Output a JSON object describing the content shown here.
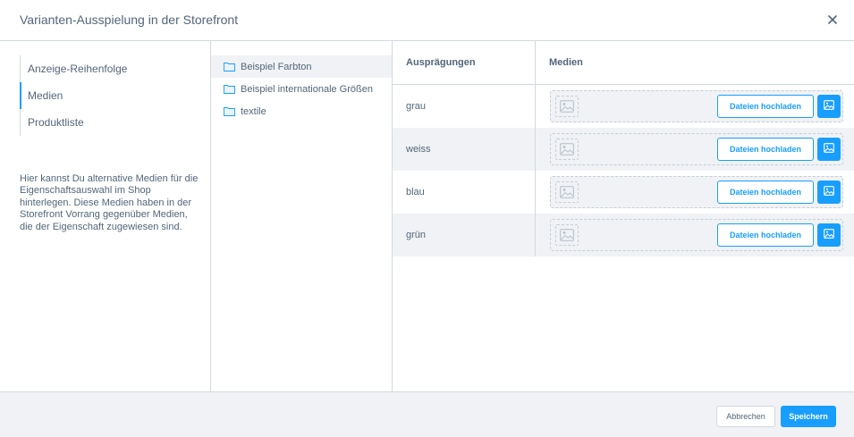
{
  "modal": {
    "title": "Varianten-Ausspielung in der Storefront",
    "close_icon": "close-icon"
  },
  "nav": {
    "items": [
      {
        "label": "Anzeige-Reihenfolge",
        "active": false
      },
      {
        "label": "Medien",
        "active": true
      },
      {
        "label": "Produktliste",
        "active": false
      }
    ],
    "description": "Hier kannst Du alternative Medien für die Eigenschaftsauswahl im Shop hinterlegen. Diese Medien haben in der Storefront Vorrang gegenüber Medien, die der Eigenschaft zugewiesen sind."
  },
  "groups": {
    "icon": "folder-icon",
    "items": [
      {
        "label": "Beispiel Farbton",
        "active": true
      },
      {
        "label": "Beispiel internationale Größen",
        "active": false
      },
      {
        "label": "textile",
        "active": false
      }
    ]
  },
  "table": {
    "headers": {
      "name": "Ausprägungen",
      "media": "Medien"
    },
    "upload_label": "Dateien hochladen",
    "rows": [
      {
        "name": "grau"
      },
      {
        "name": "weiss"
      },
      {
        "name": "blau"
      },
      {
        "name": "grün"
      }
    ]
  },
  "footer": {
    "cancel_label": "Abbrechen",
    "save_label": "Speichern"
  },
  "colors": {
    "accent": "#189eff",
    "text": "#52667a",
    "border": "#d1d9e0",
    "row_alt": "#f0f2f5"
  }
}
